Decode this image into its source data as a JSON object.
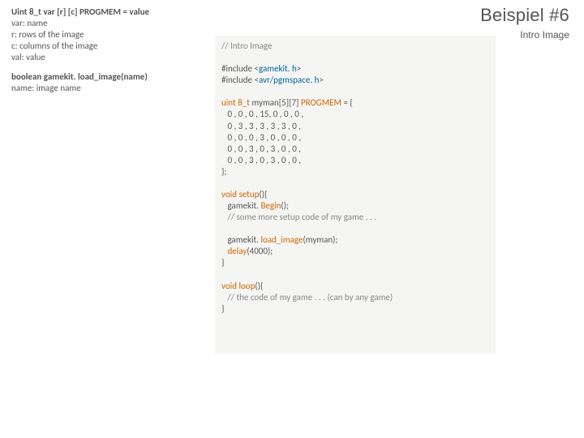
{
  "header": {
    "title": "Beispiel #6",
    "subtitle": "Intro Image"
  },
  "left": {
    "sig1": "Uint 8_t var [r] [c] PROGMEM = value",
    "l1": "var: name",
    "l2": "r: rows of the image",
    "l3": "c: columns of the image",
    "l4": "val: value",
    "sig2": "boolean gamekit. load_image(name)",
    "l5": "name: image name"
  },
  "code": {
    "comment1": "// Intro Image",
    "inc1a": "#include <",
    "inc1b": "gamekit. h",
    "inc1c": ">",
    "inc2a": "#include <",
    "inc2b": "avr/pgmspace. h",
    "inc2c": ">",
    "decl1a": "uint 8_t ",
    "decl1b": "myman[5][7] ",
    "decl1c": "PROGMEM ",
    "decl1d": "= {",
    "row1": "   0 , 0 , 0 , 15, 0 , 0 , 0 ,",
    "row2": "   0 , 3 , 3 , 3 , 3 , 3 , 0 ,",
    "row3": "   0 , 0 , 0 , 3 , 0 , 0 , 0 ,",
    "row4": "   0 , 0 , 3 , 0 , 3 , 0 , 0 ,",
    "row5": "   0 , 0 , 3 , 0 , 3 , 0 , 0 ,",
    "declend": "};",
    "setup1a": "void ",
    "setup1b": "setup",
    "setup1c": "(){",
    "setup2a": "   gamekit. ",
    "setup2b": "Begin",
    "setup2c": "();",
    "setup3": "   // some more setup code of my game . . .",
    "setup4a": "   gamekit. ",
    "setup4b": "load_image",
    "setup4c": "(myman);",
    "setup5a": "   delay",
    "setup5b": "(4000);",
    "setupend": "}",
    "loop1a": "void ",
    "loop1b": "loop",
    "loop1c": "(){",
    "loop2": "   // the code of my game . . . (can by any game)",
    "loopend": "}"
  }
}
